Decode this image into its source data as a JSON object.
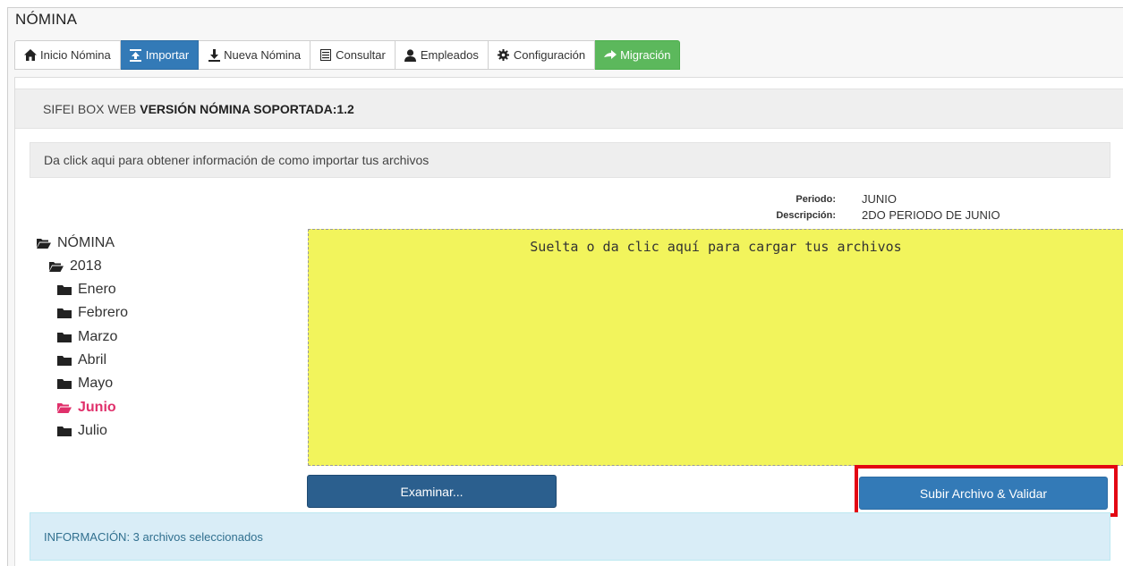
{
  "app": {
    "title": "NÓMINA"
  },
  "tabs": [
    {
      "label": "Inicio Nómina",
      "icon": "home-icon"
    },
    {
      "label": "Importar",
      "icon": "import-icon",
      "active": true
    },
    {
      "label": "Nueva Nómina",
      "icon": "download-icon"
    },
    {
      "label": "Consultar",
      "icon": "list-icon"
    },
    {
      "label": "Empleados",
      "icon": "user-icon"
    },
    {
      "label": "Configuración",
      "icon": "gear-icon"
    },
    {
      "label": "Migración",
      "icon": "arrow-right-icon",
      "color": "#5cb85c"
    }
  ],
  "header": {
    "prefix": "SIFEI BOX WEB",
    "version": "VERSIÓN NÓMINA SOPORTADA:1.2"
  },
  "help": {
    "text": "Da click aqui para obtener información de como importar tus archivos"
  },
  "meta": {
    "periodo_label": "Periodo:",
    "periodo_value": "JUNIO",
    "descripcion_label": "Descripción:",
    "descripcion_value": "2DO PERIODO DE JUNIO"
  },
  "tree": {
    "root": "NÓMINA",
    "year": "2018",
    "months": [
      "Enero",
      "Febrero",
      "Marzo",
      "Abril",
      "Mayo",
      "Junio",
      "Julio"
    ],
    "active_month": "Junio",
    "active_color": "#e0306b"
  },
  "dropzone": {
    "text": "Suelta o da clic aquí para cargar tus archivos",
    "color": "#f2f45c"
  },
  "buttons": {
    "browse": "Examinar...",
    "upload": "Subir Archivo & Validar"
  },
  "info": {
    "text": "INFORMACIÓN: 3 archivos seleccionados"
  }
}
